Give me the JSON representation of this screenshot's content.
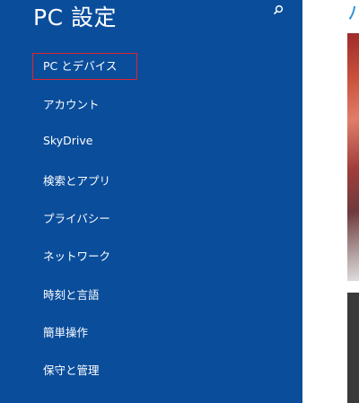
{
  "sidebar": {
    "title": "PC 設定",
    "search_icon": "search-icon",
    "items": [
      {
        "label": "PC とデバイス",
        "selected": true
      },
      {
        "label": "アカウント"
      },
      {
        "label": "SkyDrive"
      },
      {
        "label": "検索とアプリ"
      },
      {
        "label": "プライバシー"
      },
      {
        "label": "ネットワーク"
      },
      {
        "label": "時刻と言語"
      },
      {
        "label": "簡単操作"
      },
      {
        "label": "保守と管理"
      }
    ]
  },
  "main": {
    "title_partial": "ハ"
  },
  "colors": {
    "sidebar_bg": "#0a4d9b",
    "selection_border": "#e3232f",
    "accent_text": "#2a8fd8"
  }
}
